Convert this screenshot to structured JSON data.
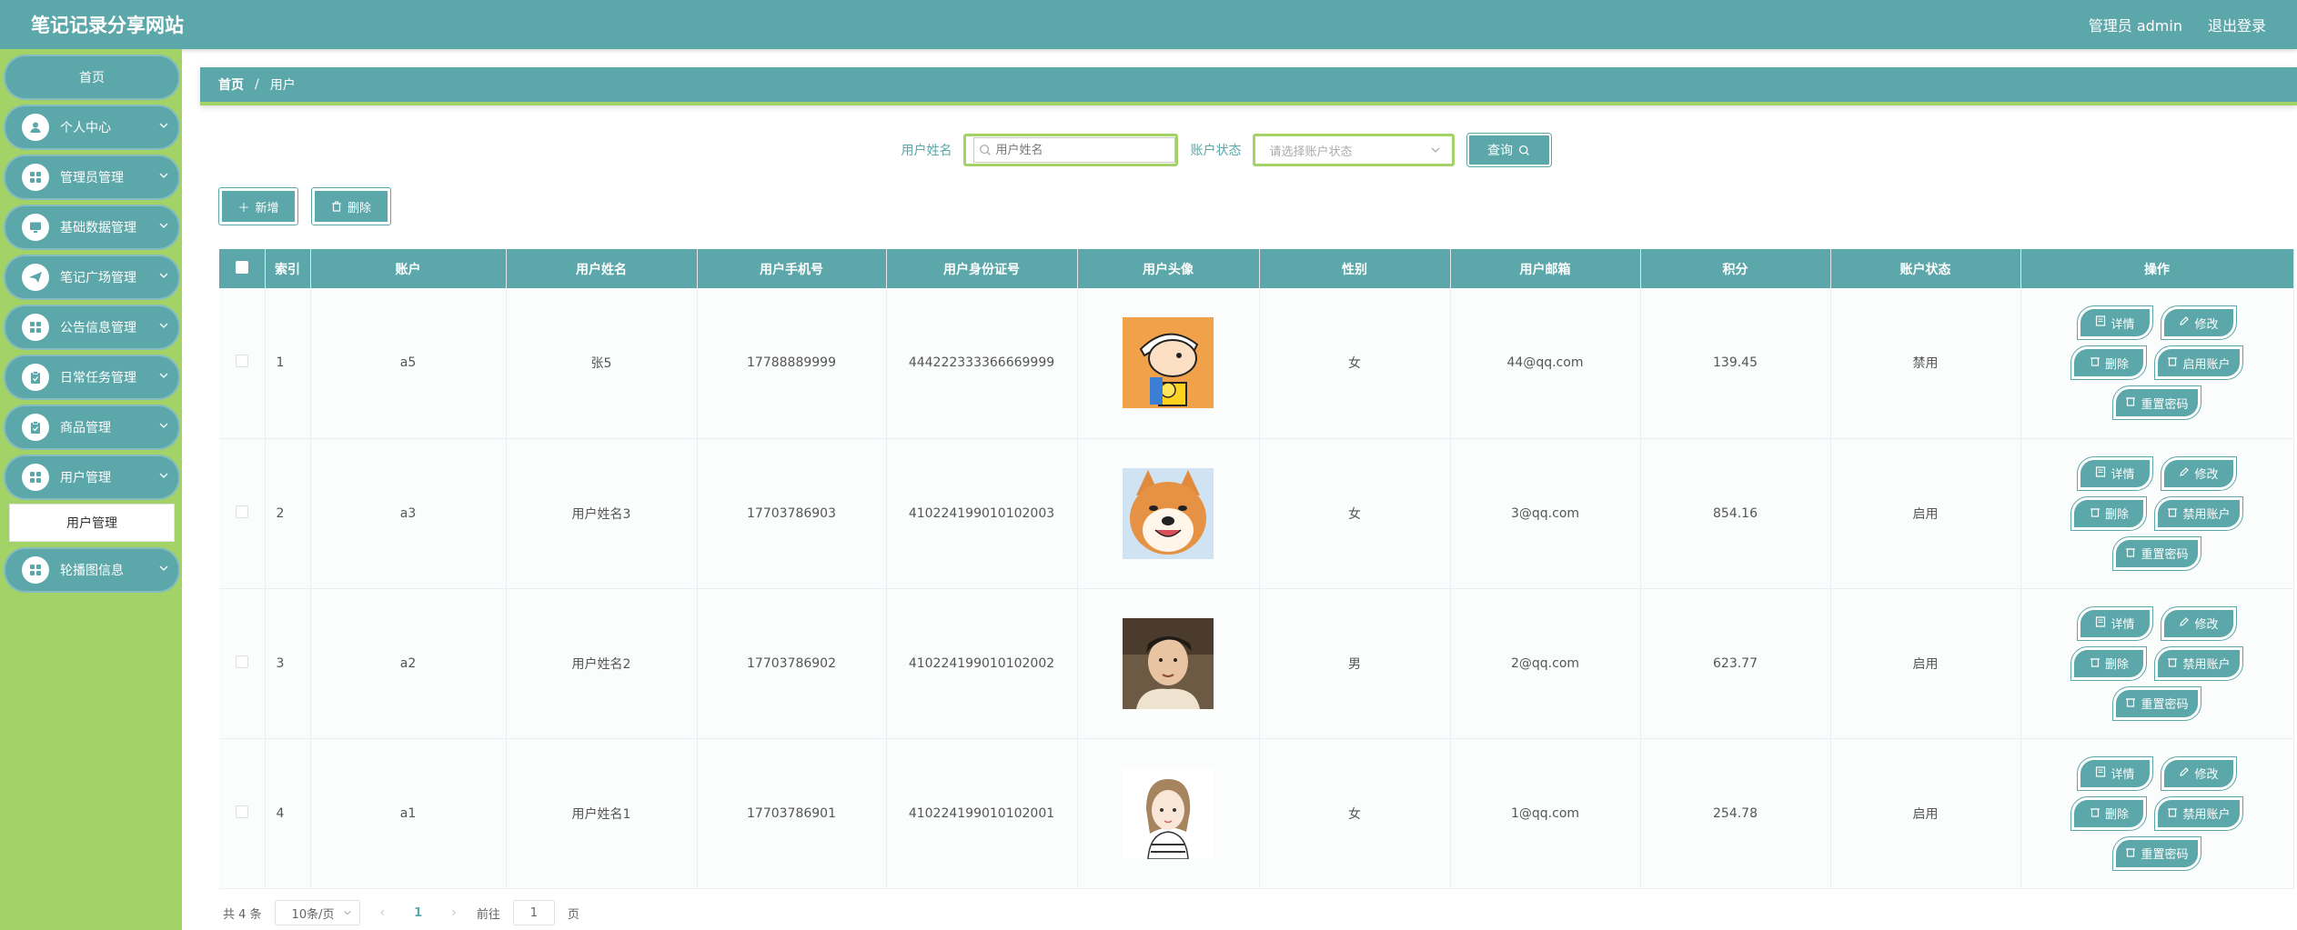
{
  "header": {
    "title": "笔记记录分享网站",
    "user_label": "管理员 admin",
    "logout_label": "退出登录"
  },
  "sidebar": {
    "home_label": "首页",
    "items": [
      {
        "label": "个人中心",
        "icon": "user-icon"
      },
      {
        "label": "管理员管理",
        "icon": "grid-icon"
      },
      {
        "label": "基础数据管理",
        "icon": "monitor-icon"
      },
      {
        "label": "笔记广场管理",
        "icon": "send-icon"
      },
      {
        "label": "公告信息管理",
        "icon": "grid-icon"
      },
      {
        "label": "日常任务管理",
        "icon": "clipboard-icon"
      },
      {
        "label": "商品管理",
        "icon": "clipboard-icon"
      },
      {
        "label": "用户管理",
        "icon": "grid-icon"
      },
      {
        "label": "轮播图信息",
        "icon": "grid-icon"
      }
    ],
    "submenu_label": "用户管理"
  },
  "breadcrumb": {
    "home": "首页",
    "separator": "/",
    "current": "用户"
  },
  "search": {
    "name_label": "用户姓名",
    "name_placeholder": "用户姓名",
    "status_label": "账户状态",
    "status_placeholder": "请选择账户状态",
    "query_label": "查询"
  },
  "actions": {
    "add_label": "新增",
    "delete_label": "删除"
  },
  "table": {
    "headers": [
      "索引",
      "账户",
      "用户姓名",
      "用户手机号",
      "用户身份证号",
      "用户头像",
      "性别",
      "用户邮箱",
      "积分",
      "账户状态",
      "操作"
    ],
    "rows": [
      {
        "index": "1",
        "account": "a5",
        "name": "张5",
        "phone": "17788889999",
        "id_card": "444222333366669999",
        "avatar": "cartoon-boy-avatar",
        "gender": "女",
        "email": "44@qq.com",
        "points": "139.45",
        "status": "禁用",
        "toggle_label": "启用账户"
      },
      {
        "index": "2",
        "account": "a3",
        "name": "用户姓名3",
        "phone": "17703786903",
        "id_card": "410224199010102003",
        "avatar": "shiba-dog-avatar",
        "gender": "女",
        "email": "3@qq.com",
        "points": "854.16",
        "status": "启用",
        "toggle_label": "禁用账户"
      },
      {
        "index": "3",
        "account": "a2",
        "name": "用户姓名2",
        "phone": "17703786902",
        "id_card": "410224199010102002",
        "avatar": "young-man-avatar",
        "gender": "男",
        "email": "2@qq.com",
        "points": "623.77",
        "status": "启用",
        "toggle_label": "禁用账户"
      },
      {
        "index": "4",
        "account": "a1",
        "name": "用户姓名1",
        "phone": "17703786901",
        "id_card": "410224199010102001",
        "avatar": "girl-illustration-avatar",
        "gender": "女",
        "email": "1@qq.com",
        "points": "254.78",
        "status": "启用",
        "toggle_label": "禁用账户"
      }
    ],
    "op_labels": {
      "detail": "详情",
      "edit": "修改",
      "delete": "删除",
      "reset": "重置密码"
    }
  },
  "pagination": {
    "total": "共 4 条",
    "page_size": "10条/页",
    "current_page": "1",
    "goto_label": "前往",
    "goto_value": "1",
    "page_suffix": "页"
  },
  "colors": {
    "primary": "#5ca7a9",
    "sidebar": "#a3d366"
  }
}
